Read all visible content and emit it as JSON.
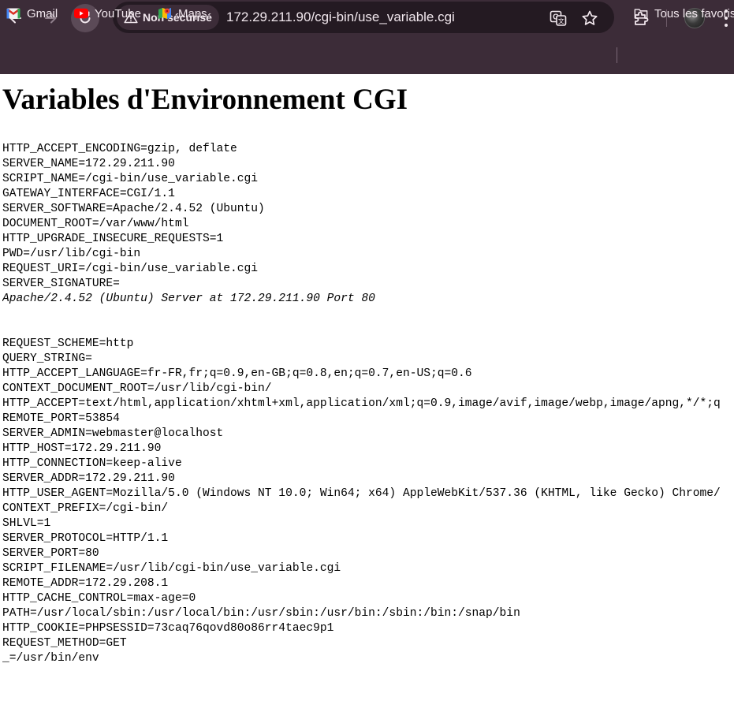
{
  "browser": {
    "security_label": "Non sécurisé",
    "url": "172.29.211.90/cgi-bin/use_variable.cgi",
    "icons": {
      "back": "arrow-left-icon",
      "forward": "arrow-right-icon",
      "reload": "reload-icon",
      "warning": "warning-triangle-icon",
      "translate": "translate-icon",
      "star": "star-icon",
      "extensions": "puzzle-icon",
      "menu": "kebab-menu-icon"
    },
    "colors": {
      "chrome_bg": "#3c2c38",
      "omnibox_bg": "#241a22",
      "text": "#f2e8ee"
    }
  },
  "bookmarks": {
    "items": [
      {
        "label": "Gmail",
        "icon": "gmail-icon"
      },
      {
        "label": "YouTube",
        "icon": "youtube-icon"
      },
      {
        "label": "Maps",
        "icon": "maps-icon"
      }
    ],
    "all_bookmarks_label": "Tous les favoris"
  },
  "page": {
    "title": "Variables d'Environnement CGI",
    "env_lines": [
      {
        "text": "HTTP_ACCEPT_ENCODING=gzip, deflate",
        "style": "normal"
      },
      {
        "text": "SERVER_NAME=172.29.211.90",
        "style": "normal"
      },
      {
        "text": "SCRIPT_NAME=/cgi-bin/use_variable.cgi",
        "style": "normal"
      },
      {
        "text": "GATEWAY_INTERFACE=CGI/1.1",
        "style": "normal"
      },
      {
        "text": "SERVER_SOFTWARE=Apache/2.4.52 (Ubuntu)",
        "style": "normal"
      },
      {
        "text": "DOCUMENT_ROOT=/var/www/html",
        "style": "normal"
      },
      {
        "text": "HTTP_UPGRADE_INSECURE_REQUESTS=1",
        "style": "normal"
      },
      {
        "text": "PWD=/usr/lib/cgi-bin",
        "style": "normal"
      },
      {
        "text": "REQUEST_URI=/cgi-bin/use_variable.cgi",
        "style": "normal"
      },
      {
        "text": "SERVER_SIGNATURE=",
        "style": "normal"
      },
      {
        "text": "Apache/2.4.52 (Ubuntu) Server at 172.29.211.90 Port 80",
        "style": "italic"
      },
      {
        "text": "",
        "style": "blank"
      },
      {
        "text": "",
        "style": "blank"
      },
      {
        "text": "REQUEST_SCHEME=http",
        "style": "normal"
      },
      {
        "text": "QUERY_STRING=",
        "style": "normal"
      },
      {
        "text": "HTTP_ACCEPT_LANGUAGE=fr-FR,fr;q=0.9,en-GB;q=0.8,en;q=0.7,en-US;q=0.6",
        "style": "normal"
      },
      {
        "text": "CONTEXT_DOCUMENT_ROOT=/usr/lib/cgi-bin/",
        "style": "normal"
      },
      {
        "text": "HTTP_ACCEPT=text/html,application/xhtml+xml,application/xml;q=0.9,image/avif,image/webp,image/apng,*/*;q",
        "style": "normal"
      },
      {
        "text": "REMOTE_PORT=53854",
        "style": "normal"
      },
      {
        "text": "SERVER_ADMIN=webmaster@localhost",
        "style": "normal"
      },
      {
        "text": "HTTP_HOST=172.29.211.90",
        "style": "normal"
      },
      {
        "text": "HTTP_CONNECTION=keep-alive",
        "style": "normal"
      },
      {
        "text": "SERVER_ADDR=172.29.211.90",
        "style": "normal"
      },
      {
        "text": "HTTP_USER_AGENT=Mozilla/5.0 (Windows NT 10.0; Win64; x64) AppleWebKit/537.36 (KHTML, like Gecko) Chrome/",
        "style": "normal"
      },
      {
        "text": "CONTEXT_PREFIX=/cgi-bin/",
        "style": "normal"
      },
      {
        "text": "SHLVL=1",
        "style": "normal"
      },
      {
        "text": "SERVER_PROTOCOL=HTTP/1.1",
        "style": "normal"
      },
      {
        "text": "SERVER_PORT=80",
        "style": "normal"
      },
      {
        "text": "SCRIPT_FILENAME=/usr/lib/cgi-bin/use_variable.cgi",
        "style": "normal"
      },
      {
        "text": "REMOTE_ADDR=172.29.208.1",
        "style": "normal"
      },
      {
        "text": "HTTP_CACHE_CONTROL=max-age=0",
        "style": "normal"
      },
      {
        "text": "PATH=/usr/local/sbin:/usr/local/bin:/usr/sbin:/usr/bin:/sbin:/bin:/snap/bin",
        "style": "normal"
      },
      {
        "text": "HTTP_COOKIE=PHPSESSID=73caq76qovd80o86rr4taec9p1",
        "style": "normal"
      },
      {
        "text": "REQUEST_METHOD=GET",
        "style": "normal"
      },
      {
        "text": "_=/usr/bin/env",
        "style": "normal"
      }
    ]
  }
}
